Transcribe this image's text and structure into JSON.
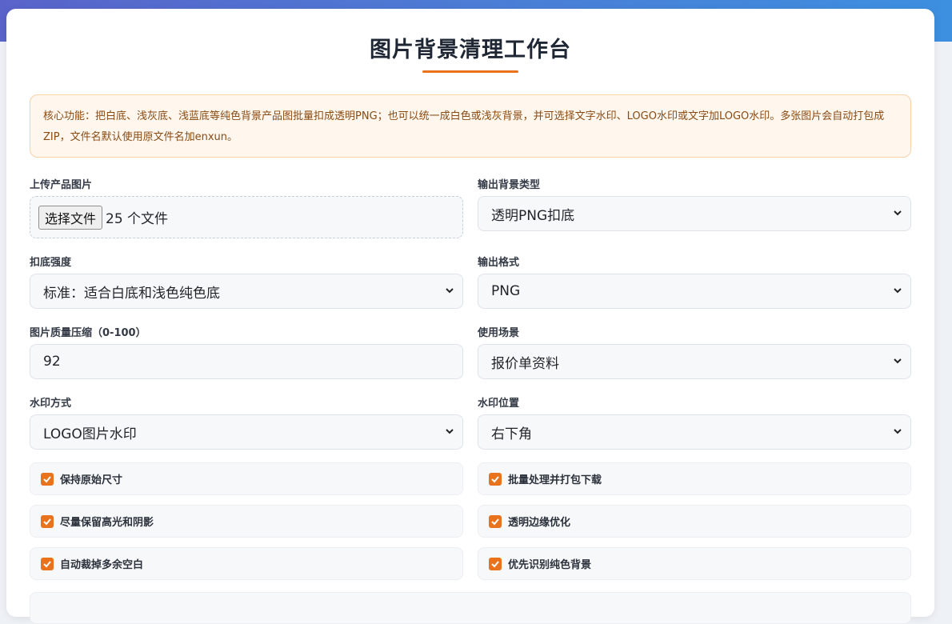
{
  "page": {
    "title": "图片背景清理工作台",
    "notice": "核心功能：把白底、浅灰底、浅蓝底等纯色背景产品图批量扣成透明PNG；也可以统一成白色或浅灰背景，并可选择文字水印、LOGO水印或文字加LOGO水印。多张图片会自动打包成ZIP，文件名默认使用原文件名加enxun。"
  },
  "form": {
    "upload": {
      "label": "上传产品图片",
      "button": "选择文件",
      "status": "25 个文件"
    },
    "bg_type": {
      "label": "输出背景类型",
      "value": "透明PNG扣底"
    },
    "strength": {
      "label": "扣底强度",
      "value": "标准：适合白底和浅色纯色底"
    },
    "format": {
      "label": "输出格式",
      "value": "PNG"
    },
    "quality": {
      "label": "图片质量压缩（0-100）",
      "value": "92"
    },
    "scene": {
      "label": "使用场景",
      "value": "报价单资料"
    },
    "wm_mode": {
      "label": "水印方式",
      "value": "LOGO图片水印"
    },
    "wm_pos": {
      "label": "水印位置",
      "value": "右下角"
    }
  },
  "options": [
    {
      "label": "保持原始尺寸",
      "checked": true
    },
    {
      "label": "批量处理并打包下载",
      "checked": true
    },
    {
      "label": "尽量保留高光和阴影",
      "checked": true
    },
    {
      "label": "透明边缘优化",
      "checked": true
    },
    {
      "label": "自动裁掉多余空白",
      "checked": true
    },
    {
      "label": "优先识别纯色背景",
      "checked": true
    }
  ],
  "theme": {
    "accent": "#e8731c",
    "header_gradient": [
      "#5a63c9",
      "#3d8fe0"
    ]
  },
  "icons": {
    "select": "chevron-down-icon",
    "checkbox": "check-icon"
  }
}
